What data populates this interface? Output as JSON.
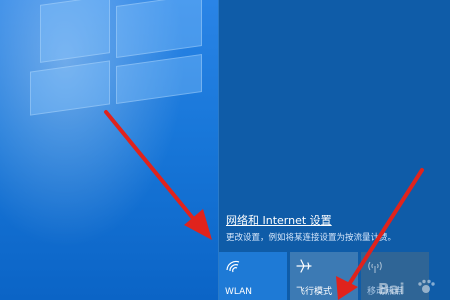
{
  "network_settings": {
    "title": "网络和 Internet 设置",
    "subtitle": "更改设置，例如将某连接设置为按流量计费。"
  },
  "quick_actions": [
    {
      "label": "WLAN",
      "icon": "wifi-icon"
    },
    {
      "label": "飞行模式",
      "icon": "airplane-icon"
    },
    {
      "label": "移动热点",
      "icon": "hotspot-icon"
    }
  ],
  "colors": {
    "panel_bg": "#0f5ca8",
    "tile_active": "#1e7ad6",
    "arrow": "#e0231c"
  },
  "watermark": {
    "text": "Bai"
  }
}
